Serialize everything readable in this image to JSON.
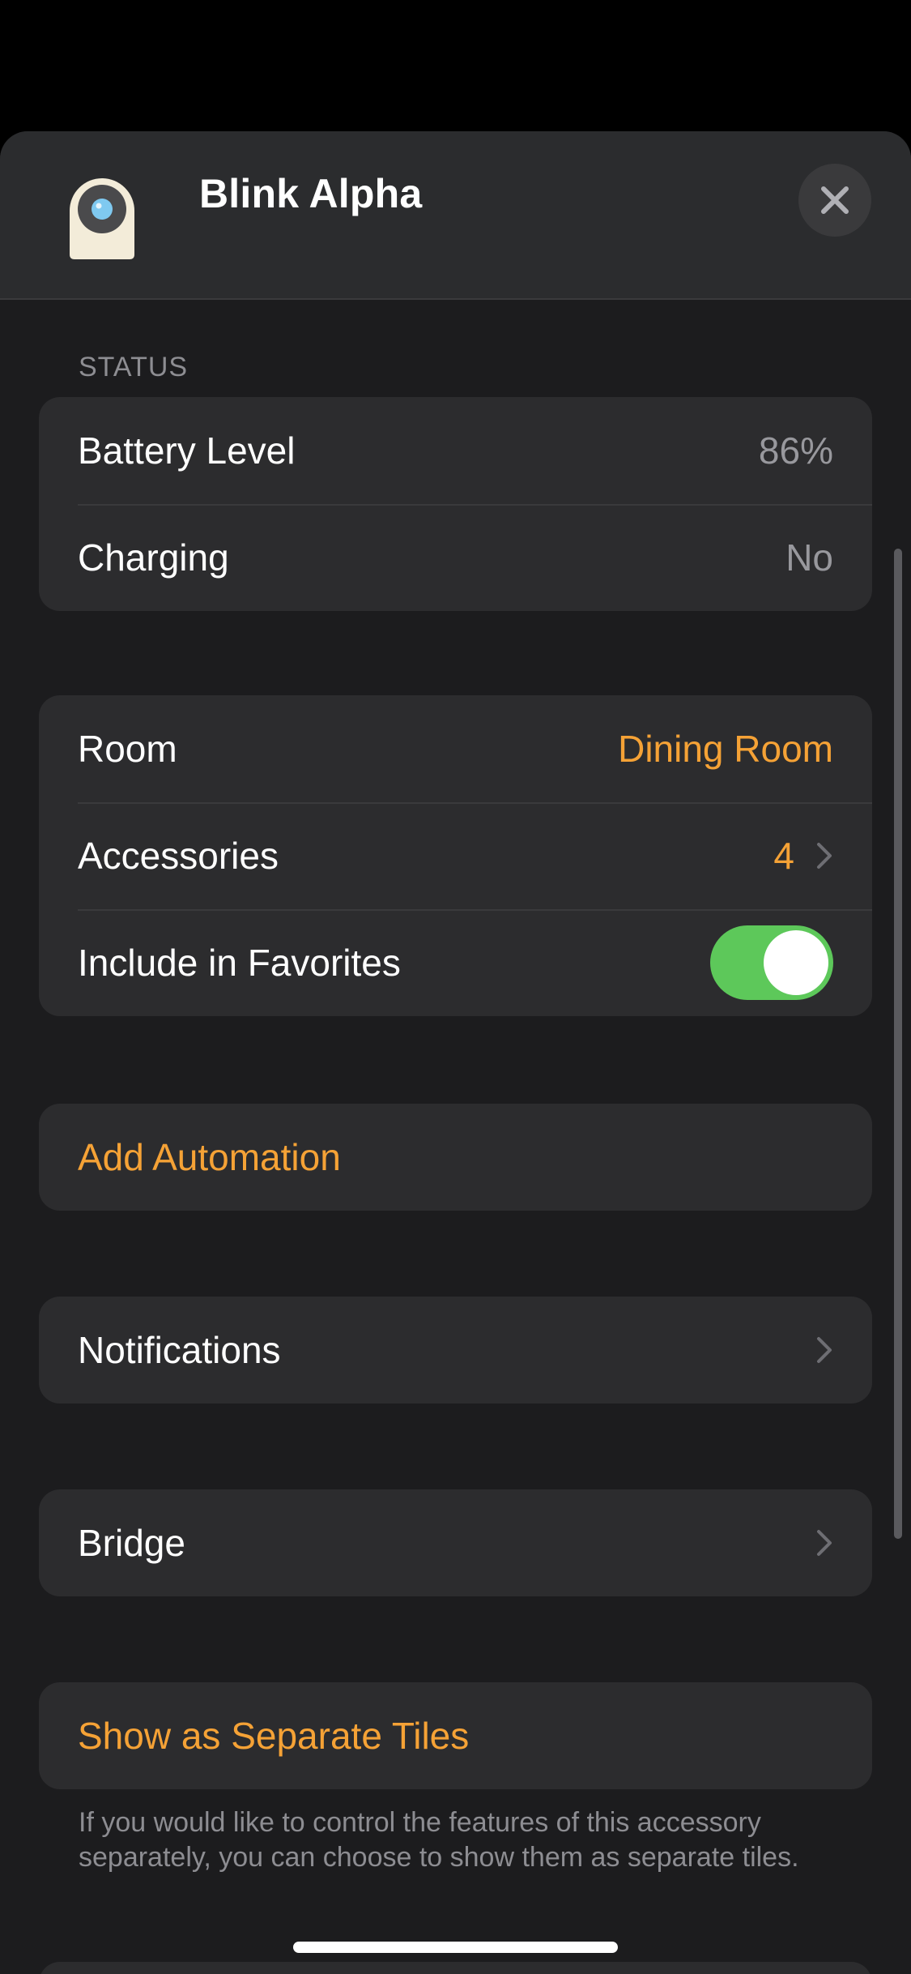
{
  "header": {
    "title": "Blink Alpha",
    "close_icon": "close-icon",
    "device_icon": "camera-icon"
  },
  "status": {
    "section_title": "STATUS",
    "rows": [
      {
        "label": "Battery Level",
        "value": "86%"
      },
      {
        "label": "Charging",
        "value": "No"
      }
    ]
  },
  "settings": {
    "room_label": "Room",
    "room_value": "Dining Room",
    "accessories_label": "Accessories",
    "accessories_value": "4",
    "favorites_label": "Include in Favorites",
    "favorites_on": true
  },
  "automation": {
    "label": "Add Automation"
  },
  "notifications": {
    "label": "Notifications"
  },
  "bridge": {
    "label": "Bridge"
  },
  "separate_tiles": {
    "label": "Show as Separate Tiles",
    "footnote": "If you would like to control the features of this accessory separately, you can choose to show them as separate tiles."
  },
  "colors": {
    "accent": "#f5a236",
    "toggle_on": "#5dc85a",
    "sheet_bg": "#1c1c1e",
    "cell_bg": "#2c2c2e"
  }
}
